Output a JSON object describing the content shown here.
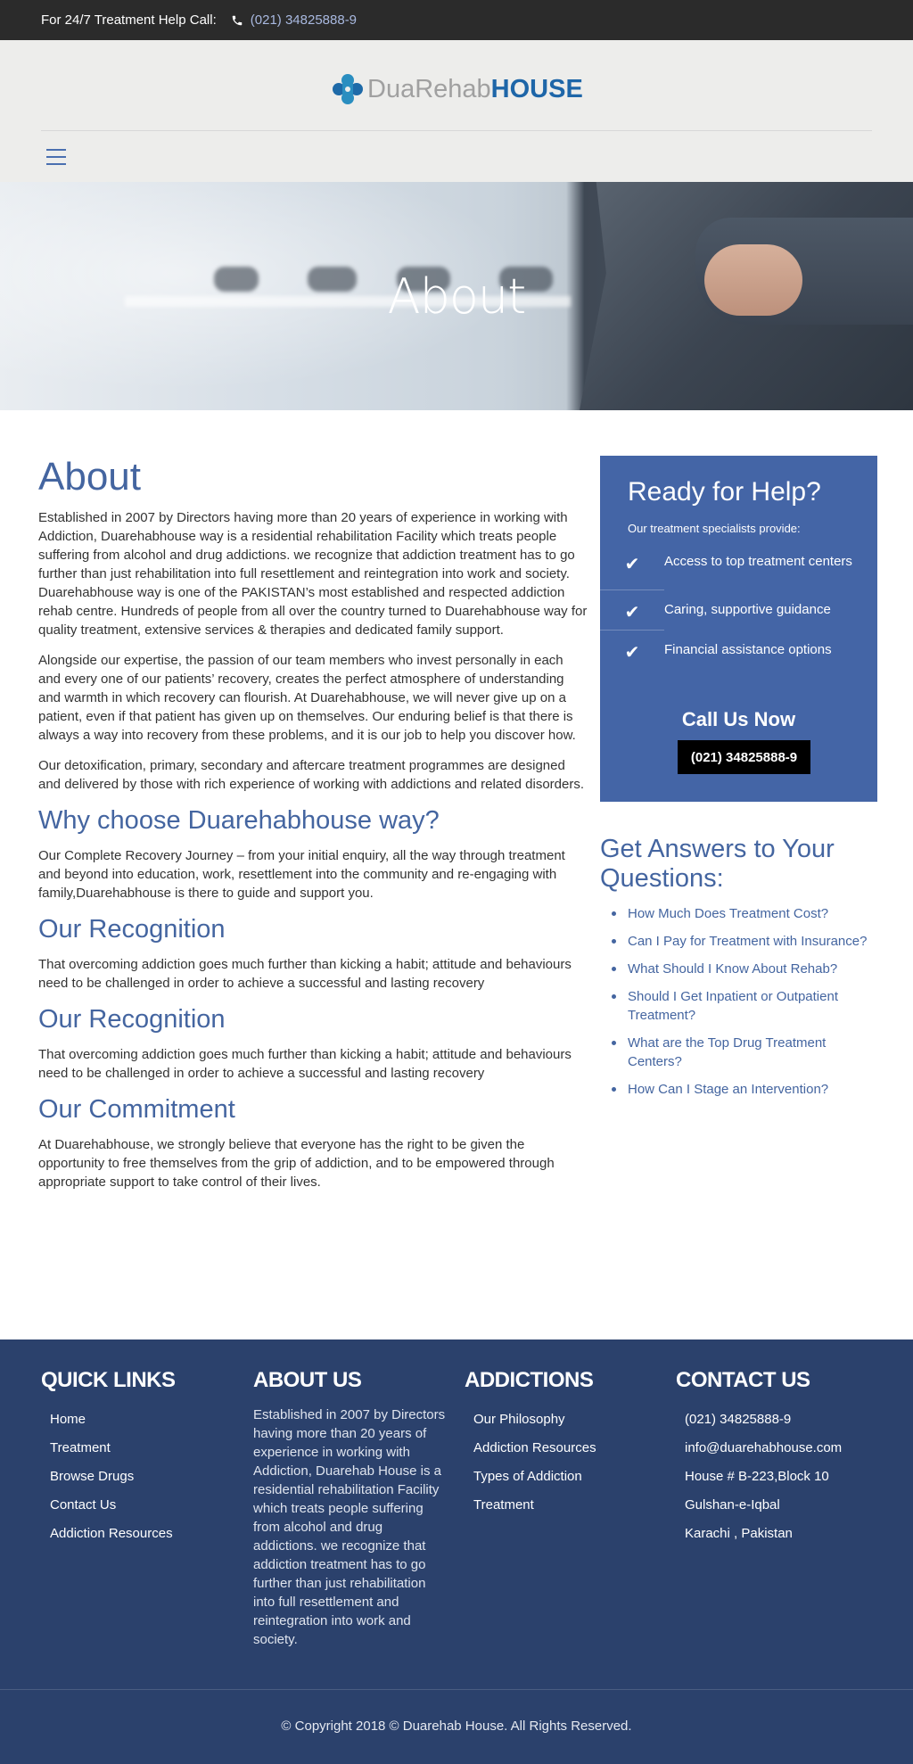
{
  "topbar": {
    "label": "For 24/7 Treatment Help Call:",
    "phone": "(021) 34825888-9"
  },
  "logo": {
    "text_a": "DuaRehab",
    "text_b": "HOUSE"
  },
  "hero": {
    "title": "About"
  },
  "main": {
    "title": "About",
    "para1": "Established in 2007 by Directors having more than 20 years of experience in working with Addiction, Duarehabhouse way is a residential rehabilitation Facility which treats people suffering from alcohol and drug addictions. we recognize that addiction treatment has to go further than just rehabilitation into full resettlement and reintegration into work and society. Duarehabhouse way is one of the PAKISTAN’s most established and respected addiction rehab centre. Hundreds of people from all over the country turned to Duarehabhouse way for quality treatment, extensive services & therapies and dedicated family support.",
    "para2": "Alongside our expertise, the passion of our team members who invest personally in each and every one of our patients’ recovery, creates the perfect atmosphere of understanding and warmth in which recovery can flourish. At Duarehabhouse, we will never give up on a patient, even if that patient has given up on themselves. Our enduring belief is that there is always a way into recovery from these problems, and it is our job to help you discover how.",
    "para3": "Our detoxification, primary, secondary and aftercare treatment programmes are designed and delivered by those with rich experience of working with addictions and related disorders.",
    "why_title": "Why choose Duarehabhouse way?",
    "why_text": "Our Complete Recovery Journey – from your initial enquiry, all the way through treatment and beyond into education, work, resettlement into the community and re-engaging with family,Duarehabhouse is there to guide and support you.",
    "recog1_title": "Our Recognition",
    "recog1_text": "That overcoming addiction goes much further than kicking a habit; attitude and behaviours need to be challenged in order to achieve a successful and lasting recovery",
    "recog2_title": "Our Recognition",
    "recog2_text": "That overcoming addiction goes much further than kicking a habit; attitude and behaviours need to be challenged in order to achieve a successful and lasting recovery",
    "commit_title": "Our Commitment",
    "commit_text": "At Duarehabhouse, we strongly believe that everyone has the right to be given the opportunity to free themselves from the grip of addiction, and to be empowered through appropriate support to take control of their lives."
  },
  "help": {
    "title": "Ready for Help?",
    "subtitle": "Our treatment specialists provide:",
    "items": [
      "Access to top treatment centers",
      "Caring, supportive guidance",
      "Financial assistance options"
    ],
    "check_glyph": "✔",
    "call_title": "Call Us Now",
    "call_button": "(021) 34825888-9"
  },
  "faq": {
    "title": "Get Answers to Your Questions:",
    "items": [
      "How Much Does Treatment Cost?",
      "Can I Pay for Treatment with Insurance?",
      "What Should I Know About Rehab?",
      "Should I Get Inpatient or Outpatient Treatment?",
      "What are the Top Drug Treatment Centers?",
      "How Can I Stage an Intervention?"
    ]
  },
  "footer": {
    "quick_links": {
      "title": "QUICK LINKS",
      "items": [
        "Home",
        "Treatment",
        "Browse Drugs",
        "Contact Us",
        "Addiction Resources"
      ]
    },
    "about": {
      "title": "ABOUT US",
      "text": "Established in 2007 by Directors having more than 20 years of experience in working with Addiction, Duarehab House is a residential rehabilitation Facility which treats people suffering from alcohol and drug addictions. we recognize that addiction treatment has to go further than just rehabilitation into full resettlement and reintegration into work and society."
    },
    "addictions": {
      "title": "ADDICTIONS",
      "items": [
        "Our Philosophy",
        "Addiction Resources",
        "Types of Addiction",
        "Treatment"
      ]
    },
    "contact": {
      "title": "CONTACT US",
      "items": [
        "(021) 34825888-9",
        "info@duarehabhouse.com",
        "House # B-223,Block 10",
        "Gulshan-e-Iqbal",
        "Karachi , Pakistan"
      ]
    },
    "copyright": "© Copyright 2018 © Duarehab House. All Rights Reserved."
  },
  "colors": {
    "accent": "#4465a0",
    "help_box": "#4465a6",
    "footer": "#2b416c",
    "topbar": "#2b2b2b",
    "logo_brand": "#1e66a8"
  },
  "icons": {
    "phone": "phone-icon",
    "menu": "hamburger-menu-icon",
    "check": "check-icon",
    "logo": "cross-logo-icon"
  }
}
